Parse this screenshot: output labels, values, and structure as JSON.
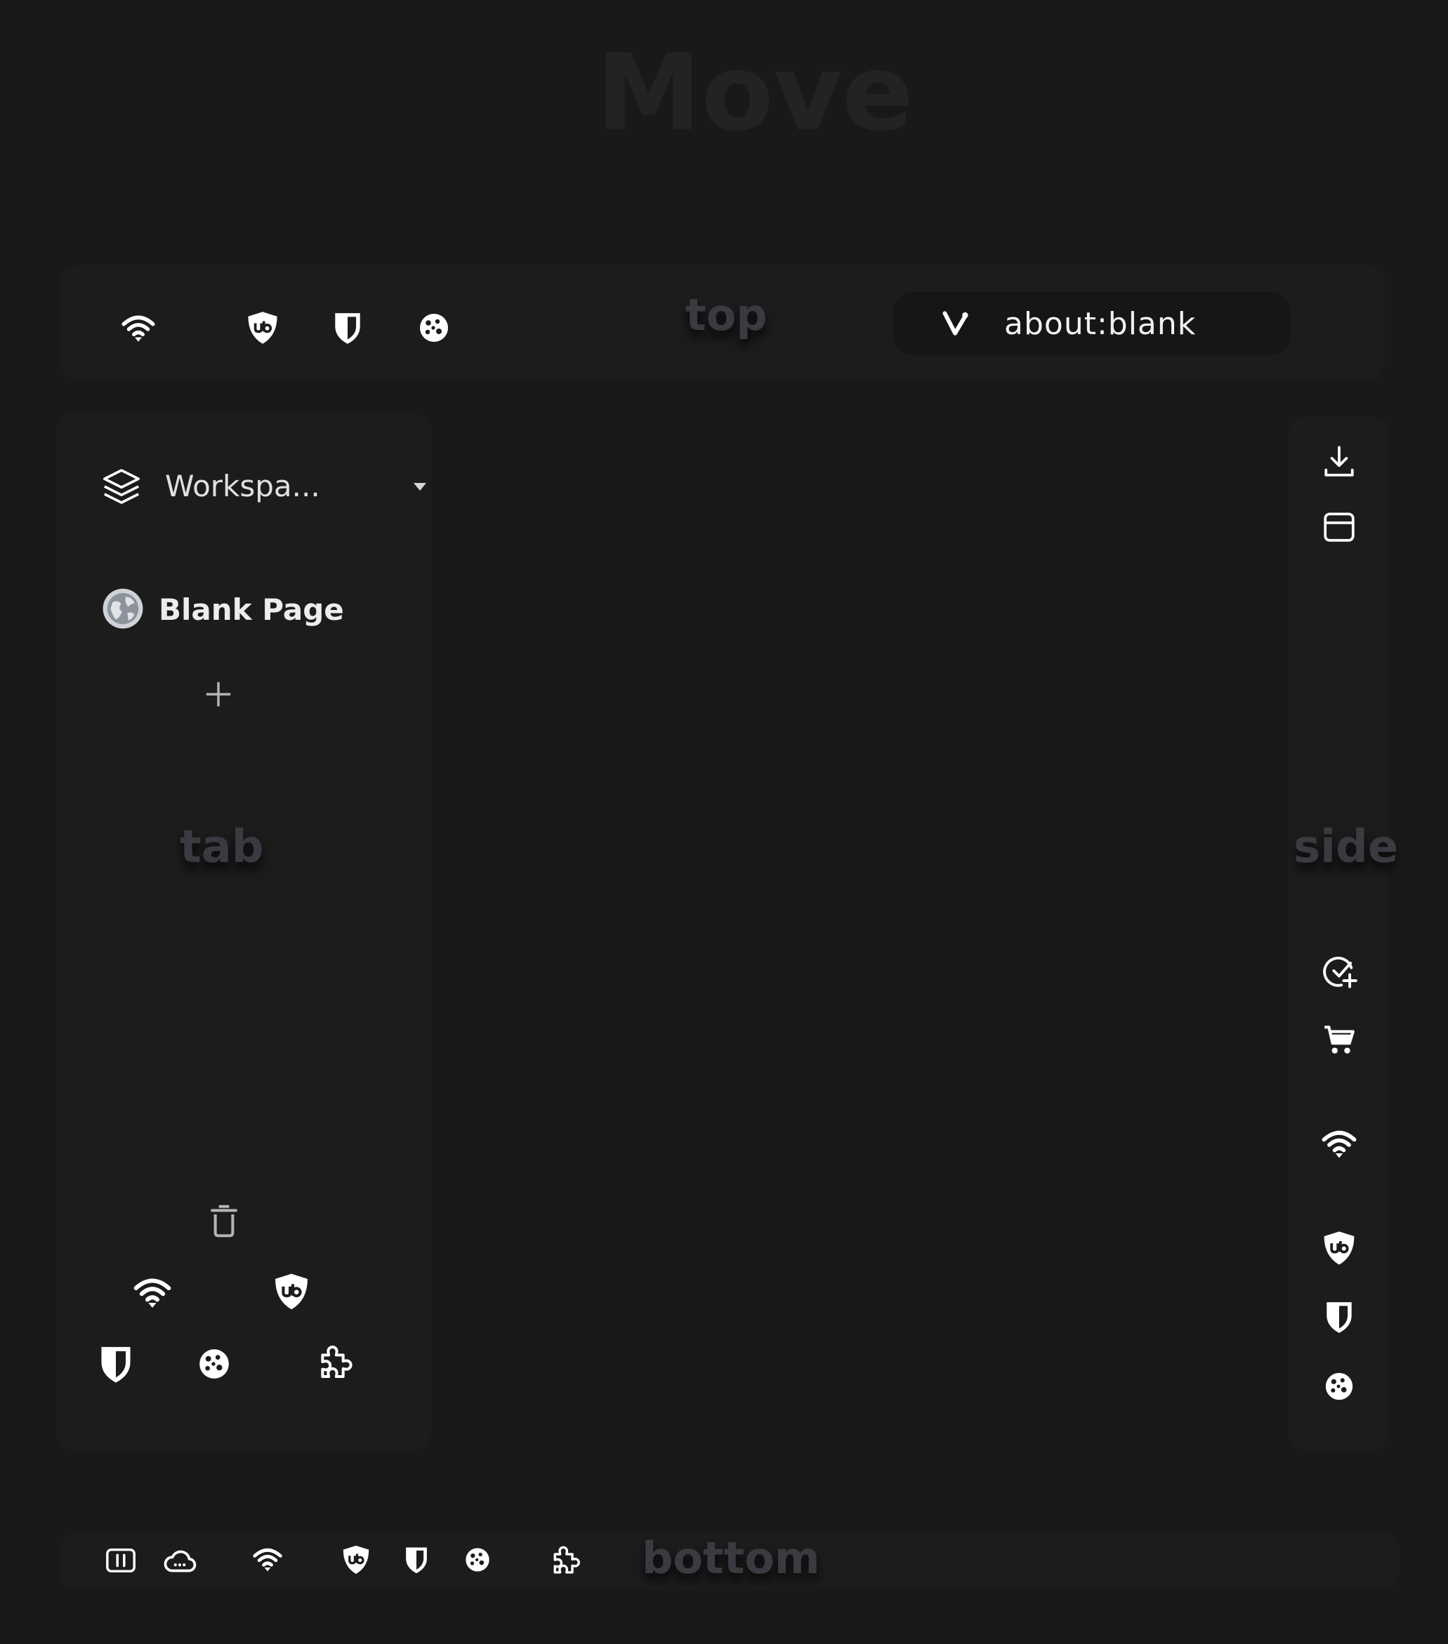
{
  "title": "Move",
  "zones": {
    "top": "top",
    "tab": "tab",
    "side": "side",
    "bottom": "bottom"
  },
  "address_bar": {
    "url": "about:blank"
  },
  "workspace": {
    "label": "Workspa..."
  },
  "tabs": [
    {
      "title": "Blank Page"
    }
  ],
  "icons": {
    "top": [
      "wifi-icon",
      "ublock-icon",
      "bitwarden-icon",
      "cookie-icon"
    ],
    "address": [
      "vivaldi-icon"
    ],
    "tab_panel": [
      "layers-icon",
      "chevron-down-icon",
      "globe-icon",
      "plus-icon",
      "trash-icon",
      "wifi-icon",
      "ublock-icon",
      "bitwarden-icon",
      "cookie-icon",
      "extensions-icon"
    ],
    "side": [
      "download-icon",
      "window-icon",
      "check-sparkle-icon",
      "cart-icon",
      "wifi-icon",
      "ublock-icon",
      "bitwarden-icon",
      "cookie-icon"
    ],
    "bottom": [
      "panel-toggle-icon",
      "cloud-icon",
      "wifi-icon",
      "ublock-icon",
      "bitwarden-icon",
      "cookie-icon",
      "extensions-icon"
    ]
  },
  "colors": {
    "background": "#191919",
    "panel": "#1c1c1d",
    "address_bg": "#161616",
    "ghost_text": "#3b3a40",
    "icon": "#ffffff"
  }
}
